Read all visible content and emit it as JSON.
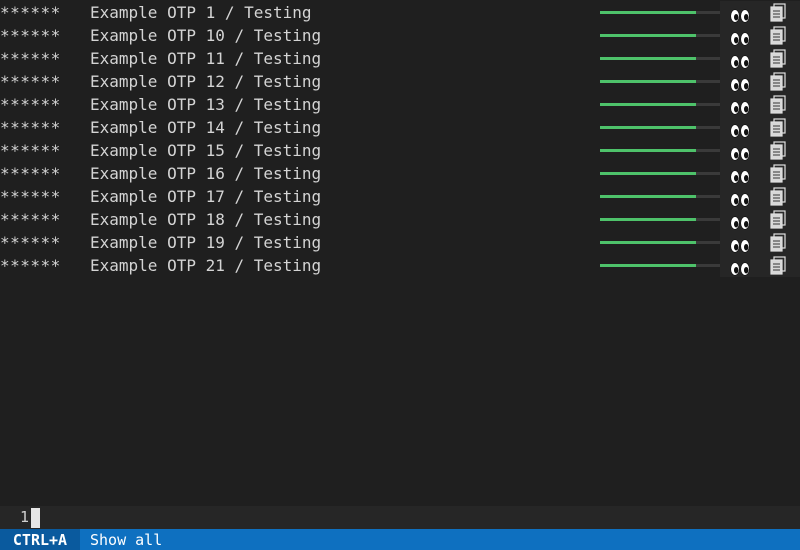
{
  "entries": [
    {
      "code": "******",
      "label": "Example OTP 1 / Testing",
      "progress": 0.8
    },
    {
      "code": "******",
      "label": "Example OTP 10 / Testing",
      "progress": 0.8
    },
    {
      "code": "******",
      "label": "Example OTP 11 / Testing",
      "progress": 0.8
    },
    {
      "code": "******",
      "label": "Example OTP 12 / Testing",
      "progress": 0.8
    },
    {
      "code": "******",
      "label": "Example OTP 13 / Testing",
      "progress": 0.8
    },
    {
      "code": "******",
      "label": "Example OTP 14 / Testing",
      "progress": 0.8
    },
    {
      "code": "******",
      "label": "Example OTP 15 / Testing",
      "progress": 0.8
    },
    {
      "code": "******",
      "label": "Example OTP 16 / Testing",
      "progress": 0.8
    },
    {
      "code": "******",
      "label": "Example OTP 17 / Testing",
      "progress": 0.8
    },
    {
      "code": "******",
      "label": "Example OTP 18 / Testing",
      "progress": 0.8
    },
    {
      "code": "******",
      "label": "Example OTP 19 / Testing",
      "progress": 0.8
    },
    {
      "code": "******",
      "label": "Example OTP 21 / Testing",
      "progress": 0.8
    }
  ],
  "icons": {
    "reveal": "eyes-icon",
    "copy": "clipboard-icon"
  },
  "input": {
    "value": "1"
  },
  "status": {
    "shortcut": "CTRL+A",
    "action": "Show all"
  },
  "colors": {
    "background": "#1f1f1f",
    "progress": "#4ec26a",
    "status_bar": "#0e70c0"
  }
}
